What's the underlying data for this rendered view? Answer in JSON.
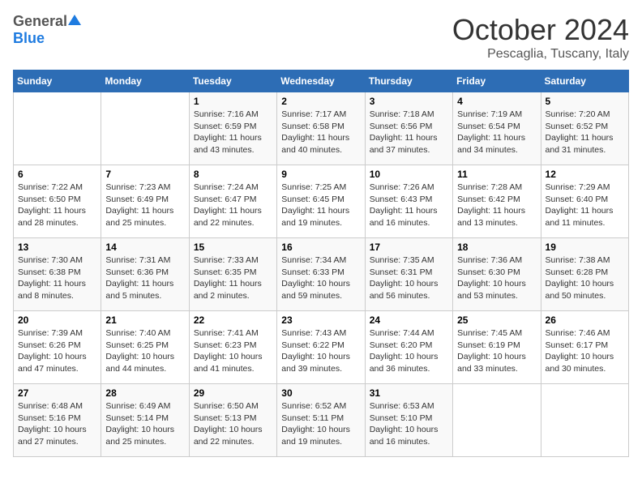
{
  "header": {
    "logo_general": "General",
    "logo_blue": "Blue",
    "month_title": "October 2024",
    "location": "Pescaglia, Tuscany, Italy"
  },
  "days_of_week": [
    "Sunday",
    "Monday",
    "Tuesday",
    "Wednesday",
    "Thursday",
    "Friday",
    "Saturday"
  ],
  "weeks": [
    [
      {
        "day": "",
        "info": ""
      },
      {
        "day": "",
        "info": ""
      },
      {
        "day": "1",
        "info": "Sunrise: 7:16 AM\nSunset: 6:59 PM\nDaylight: 11 hours and 43 minutes."
      },
      {
        "day": "2",
        "info": "Sunrise: 7:17 AM\nSunset: 6:58 PM\nDaylight: 11 hours and 40 minutes."
      },
      {
        "day": "3",
        "info": "Sunrise: 7:18 AM\nSunset: 6:56 PM\nDaylight: 11 hours and 37 minutes."
      },
      {
        "day": "4",
        "info": "Sunrise: 7:19 AM\nSunset: 6:54 PM\nDaylight: 11 hours and 34 minutes."
      },
      {
        "day": "5",
        "info": "Sunrise: 7:20 AM\nSunset: 6:52 PM\nDaylight: 11 hours and 31 minutes."
      }
    ],
    [
      {
        "day": "6",
        "info": "Sunrise: 7:22 AM\nSunset: 6:50 PM\nDaylight: 11 hours and 28 minutes."
      },
      {
        "day": "7",
        "info": "Sunrise: 7:23 AM\nSunset: 6:49 PM\nDaylight: 11 hours and 25 minutes."
      },
      {
        "day": "8",
        "info": "Sunrise: 7:24 AM\nSunset: 6:47 PM\nDaylight: 11 hours and 22 minutes."
      },
      {
        "day": "9",
        "info": "Sunrise: 7:25 AM\nSunset: 6:45 PM\nDaylight: 11 hours and 19 minutes."
      },
      {
        "day": "10",
        "info": "Sunrise: 7:26 AM\nSunset: 6:43 PM\nDaylight: 11 hours and 16 minutes."
      },
      {
        "day": "11",
        "info": "Sunrise: 7:28 AM\nSunset: 6:42 PM\nDaylight: 11 hours and 13 minutes."
      },
      {
        "day": "12",
        "info": "Sunrise: 7:29 AM\nSunset: 6:40 PM\nDaylight: 11 hours and 11 minutes."
      }
    ],
    [
      {
        "day": "13",
        "info": "Sunrise: 7:30 AM\nSunset: 6:38 PM\nDaylight: 11 hours and 8 minutes."
      },
      {
        "day": "14",
        "info": "Sunrise: 7:31 AM\nSunset: 6:36 PM\nDaylight: 11 hours and 5 minutes."
      },
      {
        "day": "15",
        "info": "Sunrise: 7:33 AM\nSunset: 6:35 PM\nDaylight: 11 hours and 2 minutes."
      },
      {
        "day": "16",
        "info": "Sunrise: 7:34 AM\nSunset: 6:33 PM\nDaylight: 10 hours and 59 minutes."
      },
      {
        "day": "17",
        "info": "Sunrise: 7:35 AM\nSunset: 6:31 PM\nDaylight: 10 hours and 56 minutes."
      },
      {
        "day": "18",
        "info": "Sunrise: 7:36 AM\nSunset: 6:30 PM\nDaylight: 10 hours and 53 minutes."
      },
      {
        "day": "19",
        "info": "Sunrise: 7:38 AM\nSunset: 6:28 PM\nDaylight: 10 hours and 50 minutes."
      }
    ],
    [
      {
        "day": "20",
        "info": "Sunrise: 7:39 AM\nSunset: 6:26 PM\nDaylight: 10 hours and 47 minutes."
      },
      {
        "day": "21",
        "info": "Sunrise: 7:40 AM\nSunset: 6:25 PM\nDaylight: 10 hours and 44 minutes."
      },
      {
        "day": "22",
        "info": "Sunrise: 7:41 AM\nSunset: 6:23 PM\nDaylight: 10 hours and 41 minutes."
      },
      {
        "day": "23",
        "info": "Sunrise: 7:43 AM\nSunset: 6:22 PM\nDaylight: 10 hours and 39 minutes."
      },
      {
        "day": "24",
        "info": "Sunrise: 7:44 AM\nSunset: 6:20 PM\nDaylight: 10 hours and 36 minutes."
      },
      {
        "day": "25",
        "info": "Sunrise: 7:45 AM\nSunset: 6:19 PM\nDaylight: 10 hours and 33 minutes."
      },
      {
        "day": "26",
        "info": "Sunrise: 7:46 AM\nSunset: 6:17 PM\nDaylight: 10 hours and 30 minutes."
      }
    ],
    [
      {
        "day": "27",
        "info": "Sunrise: 6:48 AM\nSunset: 5:16 PM\nDaylight: 10 hours and 27 minutes."
      },
      {
        "day": "28",
        "info": "Sunrise: 6:49 AM\nSunset: 5:14 PM\nDaylight: 10 hours and 25 minutes."
      },
      {
        "day": "29",
        "info": "Sunrise: 6:50 AM\nSunset: 5:13 PM\nDaylight: 10 hours and 22 minutes."
      },
      {
        "day": "30",
        "info": "Sunrise: 6:52 AM\nSunset: 5:11 PM\nDaylight: 10 hours and 19 minutes."
      },
      {
        "day": "31",
        "info": "Sunrise: 6:53 AM\nSunset: 5:10 PM\nDaylight: 10 hours and 16 minutes."
      },
      {
        "day": "",
        "info": ""
      },
      {
        "day": "",
        "info": ""
      }
    ]
  ]
}
